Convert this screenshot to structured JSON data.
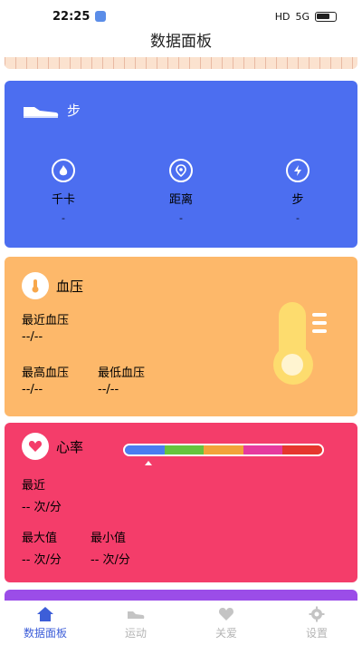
{
  "status_bar": {
    "time": "22:25",
    "network": "HD",
    "signal": "5G"
  },
  "header": {
    "title": "数据面板"
  },
  "steps_card": {
    "title": "步",
    "items": [
      {
        "label": "千卡",
        "value": "-",
        "icon": "flame-icon"
      },
      {
        "label": "距离",
        "value": "-",
        "icon": "location-icon"
      },
      {
        "label": "步",
        "value": "-",
        "icon": "lightning-icon"
      }
    ]
  },
  "bp_card": {
    "title": "血压",
    "recent_label": "最近血压",
    "recent_value": "--/--",
    "max_label": "最高血压",
    "max_value": "--/--",
    "min_label": "最低血压",
    "min_value": "--/--"
  },
  "hr_card": {
    "title": "心率",
    "recent_label": "最近",
    "recent_value": "-- 次/分",
    "max_label": "最大值",
    "max_value": "-- 次/分",
    "min_label": "最小值",
    "min_value": "-- 次/分",
    "scale_colors": [
      "#4a7df0",
      "#66c33e",
      "#f2a33a",
      "#e63a9e",
      "#e6362e"
    ]
  },
  "tabs": [
    {
      "label": "数据面板",
      "icon": "home-icon",
      "active": true
    },
    {
      "label": "运动",
      "icon": "shoe-icon",
      "active": false
    },
    {
      "label": "关爱",
      "icon": "heart-icon",
      "active": false
    },
    {
      "label": "设置",
      "icon": "gear-icon",
      "active": false
    }
  ],
  "colors": {
    "steps": "#4c6ef0",
    "bp": "#fdb86a",
    "hr": "#f43d6a",
    "accent": "#3d5ed8"
  }
}
